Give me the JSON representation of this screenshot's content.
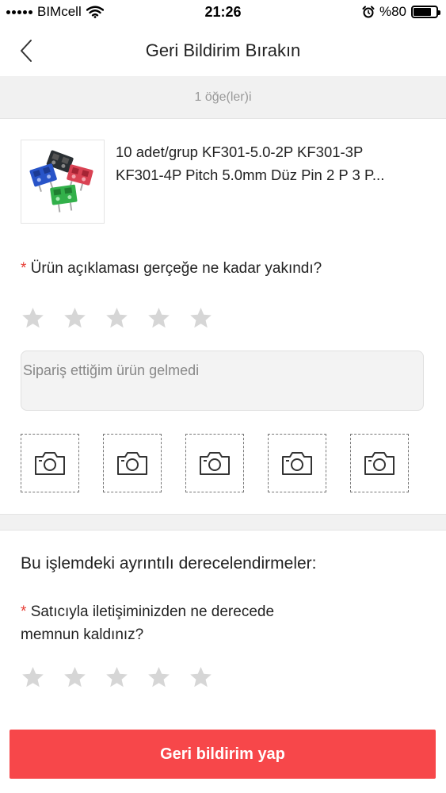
{
  "status_bar": {
    "carrier": "BIMcell",
    "time": "21:26",
    "battery": "%80",
    "battery_level": 0.8
  },
  "nav": {
    "title": "Geri Bildirim Bırakın",
    "back_icon": "chevron-left-icon"
  },
  "order": {
    "item_count": "1 öğe(ler)i"
  },
  "product": {
    "title_line1": "10 adet/grup KF301-5.0-2P KF301-3P",
    "title_line2": "KF301-4P Pitch 5.0mm Düz Pin 2 P 3 P..."
  },
  "product_rating": {
    "required_mark": "*",
    "question": "Ürün açıklaması gerçeğe ne kadar yakındı?",
    "stars": 5,
    "selected": 0
  },
  "feedback": {
    "value": "Sipariş ettiğim ürün gelmedi"
  },
  "photos": {
    "slots": 5,
    "icon": "camera-icon"
  },
  "detailed_ratings": {
    "section_title": "Bu işlemdeki ayrıntılı derecelendirmeler:",
    "required_mark": "*",
    "question_line1": "Satıcıyla iletişiminizden ne derecede",
    "question_line2": "memnun kaldınız?",
    "stars": 5,
    "selected": 0
  },
  "submit": {
    "label": "Geri bildirim yap"
  },
  "colors": {
    "accent": "#f7474a",
    "required": "#e63b32",
    "star_empty": "#d6d6d6"
  }
}
